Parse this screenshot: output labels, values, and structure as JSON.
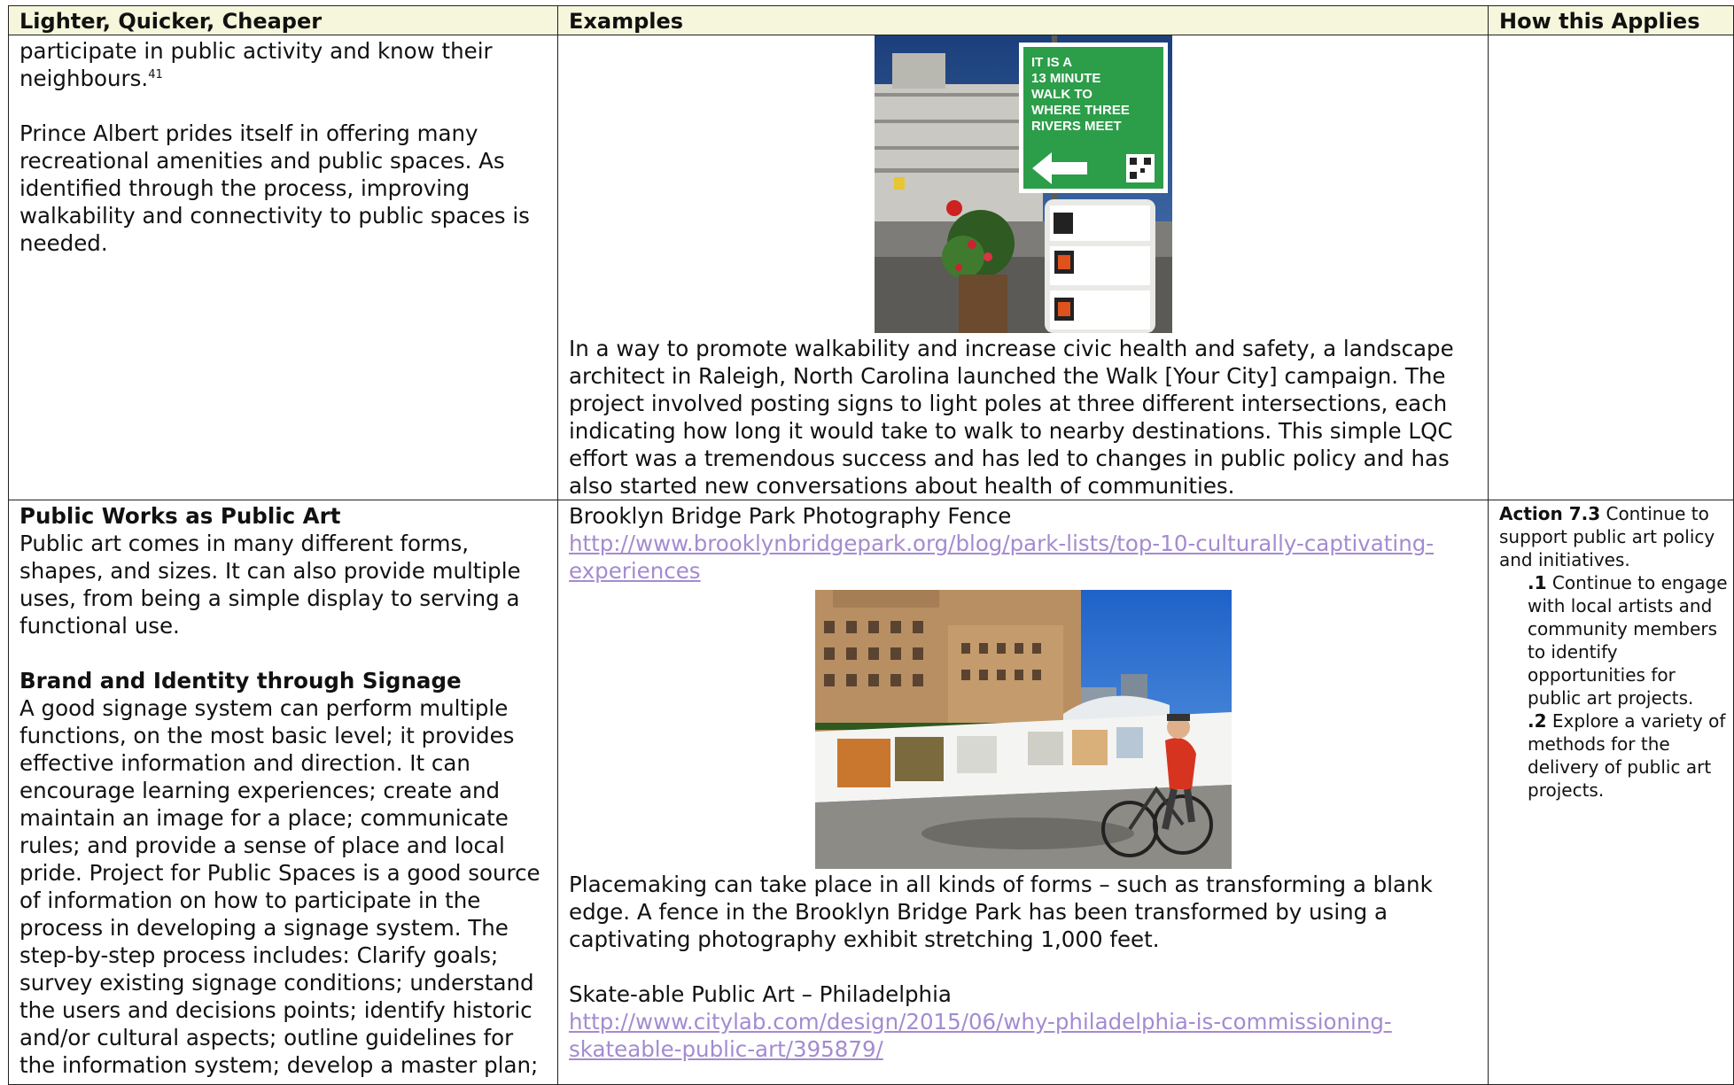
{
  "table": {
    "headers": [
      "Lighter, Quicker, Cheaper",
      "Examples",
      "How this Applies"
    ]
  },
  "row1": {
    "left": {
      "p1_text": "participate in public activity and know their neighbours.",
      "p1_sup": "41",
      "p2": "Prince Albert prides itself in offering many recreational amenities and public spaces. As identified through the process, improving walkability and connectivity to public spaces is needed."
    },
    "example": {
      "sign_text": "IT IS A 13 MINUTE WALK TO WHERE THREE RIVERS MEET",
      "caption": "In a way to promote walkability and increase civic health and safety, a landscape architect in Raleigh, North Carolina launched the Walk [Your City] campaign. The project involved posting signs to light poles at three different intersections, each indicating how long it would take to walk to nearby destinations. This simple LQC effort was a tremendous success and has led to changes in public policy and has also started new conversations about health of communities."
    }
  },
  "row2": {
    "left": {
      "h1": "Public Works as Public Art",
      "p1": "Public art comes in many different forms, shapes, and sizes. It can also provide multiple uses, from being a simple display to serving a functional use.",
      "h2": "Brand and Identity through Signage",
      "p2": "A good signage system can perform multiple functions, on the most basic level; it provides effective information and direction. It can encourage learning experiences; create and maintain an image for a place; communicate rules; and provide a sense of place and local pride. Project for Public Spaces is a good source of information on how to participate in the process in developing a signage system. The step-by-step process includes: Clarify goals; survey existing signage conditions; understand the users and decisions points; identify historic and/or cultural aspects; outline guidelines for the information system; develop a master plan;"
    },
    "example": {
      "title1": "Brooklyn Bridge Park Photography Fence",
      "link1": "http://www.brooklynbridgepark.org/blog/park-lists/top-10-culturally-captivating-experiences",
      "caption1": "Placemaking can take place in all kinds of forms – such as transforming a blank edge. A fence in the Brooklyn Bridge Park has been transformed by using a captivating photography exhibit stretching 1,000 feet.",
      "title2": "Skate-able Public Art – Philadelphia",
      "link2": "http://www.citylab.com/design/2015/06/why-philadelphia-is-commissioning-skateable-public-art/395879/"
    },
    "applies": {
      "action_label": "Action 7.3",
      "action_text": " Continue to support public art policy and initiatives.",
      "item1_num": ".1",
      "item1_text": " Continue to engage with local artists and community members to identify opportunities for public art projects.",
      "item2_num": ".2",
      "item2_text": " Explore a variety of methods for the delivery of public art projects."
    }
  }
}
